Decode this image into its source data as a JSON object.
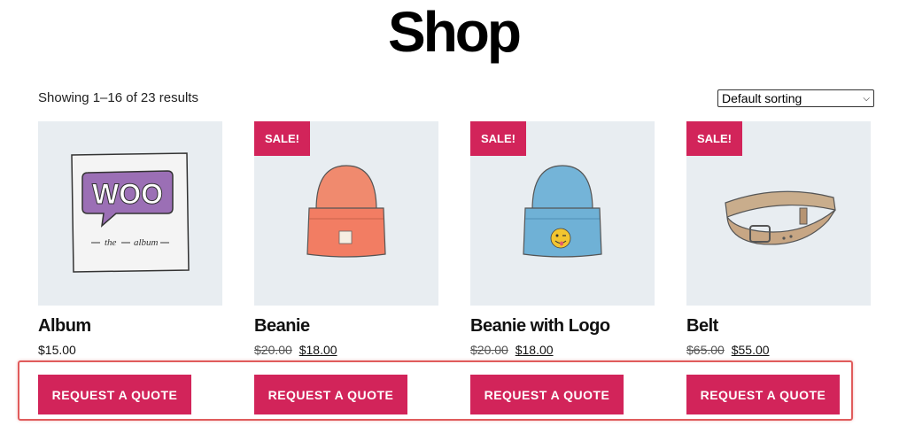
{
  "page": {
    "title": "Shop"
  },
  "toolbar": {
    "result_count": "Showing 1–16 of 23 results",
    "sorting_selected": "Default sorting"
  },
  "products": [
    {
      "name": "Album",
      "price": "$15.00",
      "regular_price": "",
      "sale": false,
      "button": "REQUEST A QUOTE",
      "image": "album-icon"
    },
    {
      "name": "Beanie",
      "regular_price": "$20.00",
      "price": "$18.00",
      "sale": true,
      "sale_label": "SALE!",
      "button": "REQUEST A QUOTE",
      "image": "beanie-icon"
    },
    {
      "name": "Beanie with Logo",
      "regular_price": "$20.00",
      "price": "$18.00",
      "sale": true,
      "sale_label": "SALE!",
      "button": "REQUEST A QUOTE",
      "image": "beanie-logo-icon"
    },
    {
      "name": "Belt",
      "regular_price": "$65.00",
      "price": "$55.00",
      "sale": true,
      "sale_label": "SALE!",
      "button": "REQUEST A QUOTE",
      "image": "belt-icon"
    }
  ],
  "album_art": {
    "logo_text": "WOO",
    "caption_left": "the",
    "caption_right": "album"
  },
  "colors": {
    "accent": "#d2245a",
    "thumb_bg": "#e8edf1",
    "highlight": "#e05c5c"
  }
}
